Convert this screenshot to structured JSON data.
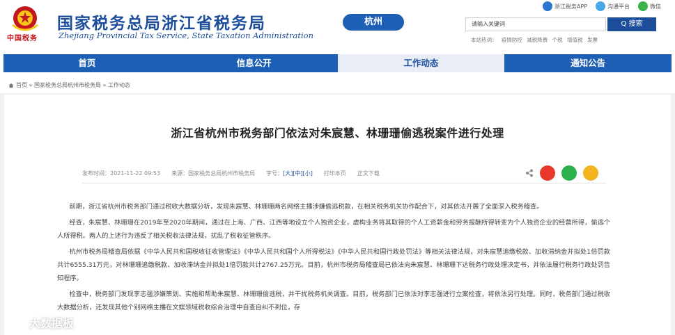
{
  "header": {
    "title_cn": "国家税务总局浙江省税务局",
    "title_en": "Zhejiang Provincial Tax Service, State Taxation Administration",
    "city": "杭州",
    "emblem_text": "中国税务",
    "top_links": [
      {
        "label": "浙江税务APP",
        "icon": "mobile-app-icon"
      },
      {
        "label": "沟通平台",
        "icon": "chat-icon"
      },
      {
        "label": "微信",
        "icon": "wechat-icon"
      }
    ],
    "search": {
      "placeholder": "请输入关键词",
      "button": "Q 搜索"
    },
    "hot_words_label": "本站热词：",
    "hot_words": [
      "疫情防控",
      "减税降费",
      "个税",
      "增值税",
      "发票"
    ]
  },
  "nav": {
    "items": [
      "首页",
      "信息公开",
      "工作动态",
      "通知公告"
    ],
    "active_index": 2
  },
  "breadcrumb": "首页 » 国家税务总局杭州市税务局 » 工作动态",
  "article": {
    "title": "浙江省杭州市税务部门依法对朱宸慧、林珊珊偷逃税案件进行处理",
    "meta": {
      "date": "发布时间：2021-11-22 09:53",
      "source": "来源：国家税务总局杭州市税务局",
      "font_label": "字号：",
      "size_large": "[大]",
      "size_medium": "[中]",
      "size_small": "[小]",
      "print": "打印本页",
      "download": "正文下载"
    },
    "paragraphs": [
      "前期，浙江省杭州市税务部门通过税收大数据分析，发现朱宸慧、林珊珊两名网络主播涉嫌偷逃税款，在相关税务机关协作配合下，对其依法开展了全面深入税务稽查。",
      "经查，朱宸慧、林珊珊在2019年至2020年期间，通过在上海、广西、江西等地设立个人独资企业，虚构业务将其取得的个人工资薪金和劳务报酬所得转变为个人独资企业的经营所得，偷逃个人所得税。两人的上述行为违反了相关税收法律法规，扰乱了税收征管秩序。",
      "杭州市税务局稽查局依据《中华人民共和国税收征收管理法》《中华人民共和国个人所得税法》《中华人民共和国行政处罚法》等相关法律法规，对朱宸慧追缴税款、加收滞纳金并拟处1倍罚款共计6555.31万元，对林珊珊追缴税款、加收滞纳金并拟处1倍罚款共计2767.25万元。目前，杭州市税务局稽查局已依法向朱宸慧、林珊珊下达税务行政处理决定书，并依法履行税务行政处罚告知程序。",
      "检查中，税务部门发现李志强涉嫌策划、实施和帮助朱宸慧、林珊珊偷逃税，并干扰税务机关调查。目前，税务部门已依法对李志强进行立案检查，将依法另行处理。同时，税务部门通过税收大数据分析，还发现其他个别网络主播在文娱领域税收综合治理中自查自纠不到位，存"
    ]
  },
  "watermark": "大数据板",
  "colors": {
    "brand_blue": "#1d4e9c",
    "nav_blue": "#1d5fb4",
    "accent_red": "#c4161c"
  }
}
